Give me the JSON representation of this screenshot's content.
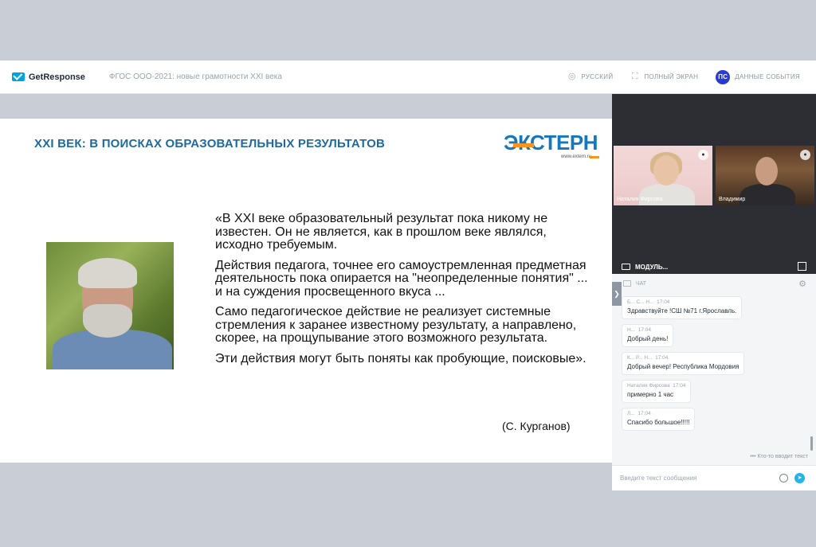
{
  "header": {
    "brand": "GetResponse",
    "event_title": "ФГОС ООО-2021: новые грамотности XXI века",
    "language": "РУССКИЙ",
    "fullscreen": "ПОЛНЫЙ ЭКРАН",
    "avatar_initials": "ПС",
    "event_data": "ДАННЫЕ СОБЫТИЯ"
  },
  "slide": {
    "title": "XXI ВЕК: В ПОИСКАХ ОБРАЗОВАТЕЛЬНЫХ РЕЗУЛЬТАТОВ",
    "logo_word": "ЭКСТЕРН",
    "logo_url": "www.extern.ru",
    "quote": [
      "«В XXI веке образовательный результат пока никому не известен. Он не является, как в прошлом веке являлся, исходно требуемым.",
      "Действия педагога, точнее его самоустремленная предметная деятельность пока опирается на \"неопределенные понятия\" ... и на суждения просвещенного вкуса ...",
      "Само педагогическое действие не реализует системные стремления к заранее известному результату, а направлено, скорее, на прощупывание этого возможного результата.",
      "Эти действия могут быть поняты как пробующие, поисковые»."
    ],
    "author": "(С. Курганов)"
  },
  "videos": [
    {
      "name": "Наталия Фирсова"
    },
    {
      "name": "Владимир"
    }
  ],
  "module_label": "МОДУЛЬ...",
  "chat": {
    "title": "ЧАТ",
    "messages": [
      {
        "author": "Б... С... Н...",
        "time": "17:04",
        "text": "Здравствуйте !СШ №71 г.Ярославль."
      },
      {
        "author": "Н...",
        "time": "17:04",
        "text": "Добрый день!"
      },
      {
        "author": "К... Р... Н...",
        "time": "17:04",
        "text": "Добрый вечер! Республика Мордовия"
      },
      {
        "author": "Наталия Фирсова",
        "time": "17:04",
        "text": "примерно 1 час"
      },
      {
        "author": "Л...",
        "time": "17:04",
        "text": "Спасибо большое!!!!!"
      }
    ],
    "typing": "Кто-то вводит текст",
    "input_placeholder": "Введите текст сообщения"
  },
  "colors": {
    "accent": "#1e6a9e",
    "brand_orange": "#f7941d",
    "avatar_bg": "#2a3bd1",
    "send_button": "#20b6e8"
  }
}
